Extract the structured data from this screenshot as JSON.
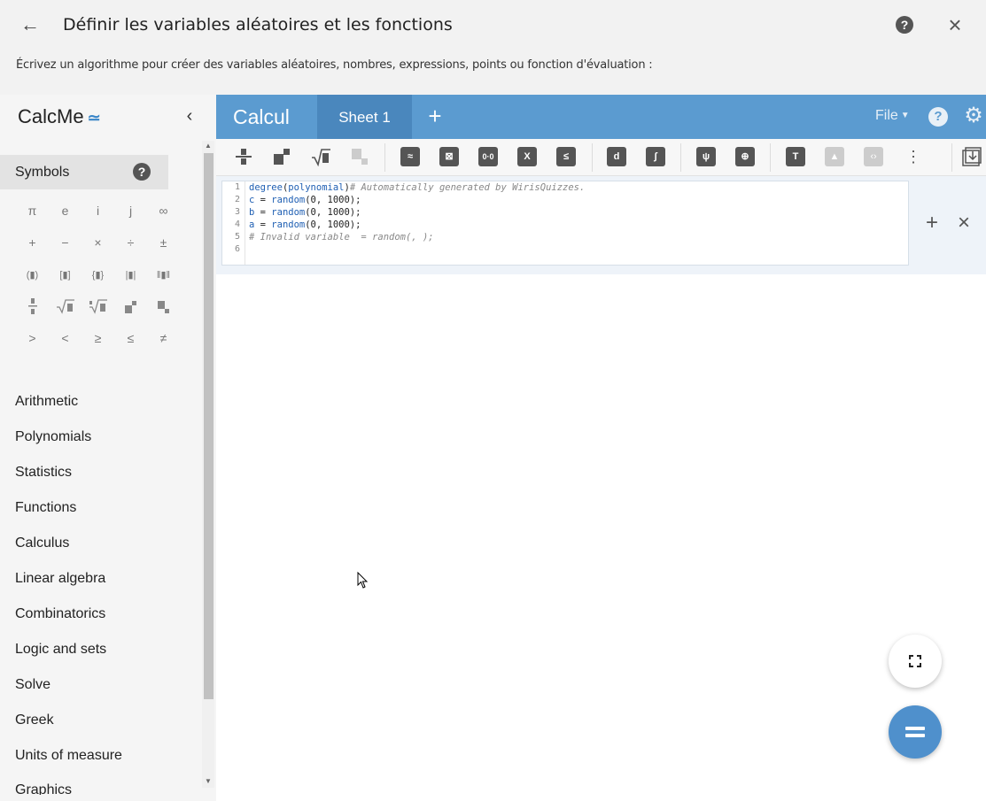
{
  "dialog": {
    "title": "Définir les variables aléatoires et les fonctions",
    "subtitle": "Écrivez un algorithme pour créer des variables aléatoires, nombres, expressions, points ou fonction d'évaluation :",
    "back_icon": "arrow-left-icon",
    "help_label": "?",
    "close_icon": "close-icon"
  },
  "sidebar": {
    "logo": "CalcMe",
    "logo_mark": "≃",
    "symbols_label": "Symbols",
    "symbols_help": "?",
    "symbols": [
      [
        "π",
        "e",
        "i",
        "j",
        "∞"
      ],
      [
        "+",
        "−",
        "×",
        "÷",
        "±"
      ],
      [
        "(▮)",
        "[▮]",
        "{▮}",
        "|▮|",
        "‖▮‖"
      ],
      [
        "fraction-icon",
        "sqrt-icon",
        "nthroot-icon",
        "superscript-icon",
        "subscript-icon"
      ],
      [
        ">",
        "<",
        "≥",
        "≤",
        "≠"
      ]
    ],
    "categories": [
      "Arithmetic",
      "Polynomials",
      "Statistics",
      "Functions",
      "Calculus",
      "Linear algebra",
      "Combinatorics",
      "Logic and sets",
      "Solve",
      "Greek",
      "Units of measure"
    ],
    "cut_category": "Graphics"
  },
  "calc": {
    "title": "Calcul",
    "sheet_tab": "Sheet 1",
    "add_sheet": "+",
    "file_menu": "File",
    "help": "?"
  },
  "editor": {
    "line_numbers": [
      "1",
      "2",
      "3",
      "4",
      "5",
      "6"
    ],
    "lines": [
      {
        "kw": "degree",
        "p1": "(",
        "kw2": "polynomial",
        "p2": ")",
        "comment": "# Automatically generated by WirisQuizzes."
      },
      {
        "var": "c",
        "op": " = ",
        "fn": "random",
        "args": "(0, 1000);"
      },
      {
        "var": "b",
        "op": " = ",
        "fn": "random",
        "args": "(0, 1000);"
      },
      {
        "var": "a",
        "op": " = ",
        "fn": "random",
        "args": "(0, 1000);"
      },
      {
        "comment": "# Invalid variable  = random(, );"
      },
      {}
    ],
    "add_label": "+",
    "close_label": "×"
  },
  "colors": {
    "accent": "#5b9bd0",
    "accent_dark": "#4a87bd",
    "fab": "#4f90cc"
  }
}
